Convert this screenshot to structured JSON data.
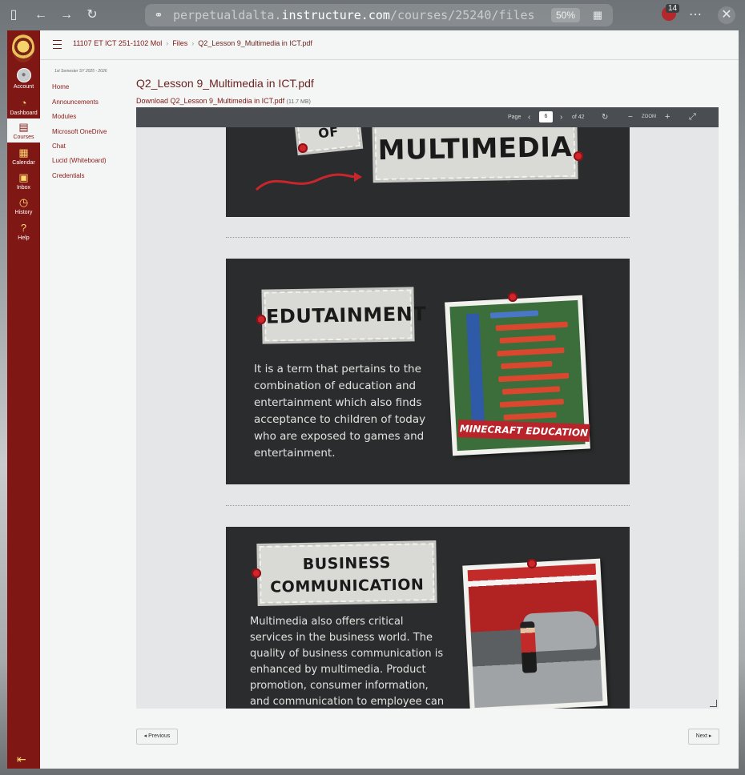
{
  "browser": {
    "url_host": "perpetualdalta.",
    "url_domain": "instructure.com",
    "url_path": "/courses/25240/files",
    "zoom": "50%",
    "extension_badge": "14"
  },
  "nav": {
    "account": "Account",
    "dashboard": "Dashboard",
    "courses": "Courses",
    "calendar": "Calendar",
    "inbox": "Inbox",
    "history": "History",
    "help": "Help"
  },
  "breadcrumb": {
    "course": "11107 ET ICT 251-1102 Mol",
    "section": "Files",
    "file": "Q2_Lesson 9_Multimedia in ICT.pdf"
  },
  "semester": "1st Semester SY 2025 - 2026",
  "course_nav": [
    "Home",
    "Announcements",
    "Modules",
    "Microsoft OneDrive",
    "Chat",
    "Lucid (Whiteboard)",
    "Credentials"
  ],
  "file": {
    "title": "Q2_Lesson 9_Multimedia in ICT.pdf",
    "download_label": "Download Q2_Lesson 9_Multimedia in ICT.pdf",
    "size": "(11.7 MB)"
  },
  "pdf_toolbar": {
    "page_label": "Page",
    "page_value": "6",
    "page_total": "of 42",
    "zoom_label": "ZOOM"
  },
  "slides": {
    "s1": {
      "title_fragment": "OF",
      "title": "MULTIMEDIA"
    },
    "s2": {
      "title": "EDUTAINMENT",
      "body": "It is a term that pertains to the combination of education and entertainment which also finds acceptance to children of today who are exposed to games and entertainment.",
      "caption": "MINECRAFT EDUCATION"
    },
    "s3": {
      "title_line1": "BUSINESS",
      "title_line2": "COMMUNICATION",
      "body": "Multimedia also offers critical services in the business world. The quality of business communication is enhanced by multimedia. Product promotion, consumer information, and communication to employee can"
    }
  },
  "pager": {
    "previous": "◂ Previous",
    "next": "Next ▸"
  }
}
